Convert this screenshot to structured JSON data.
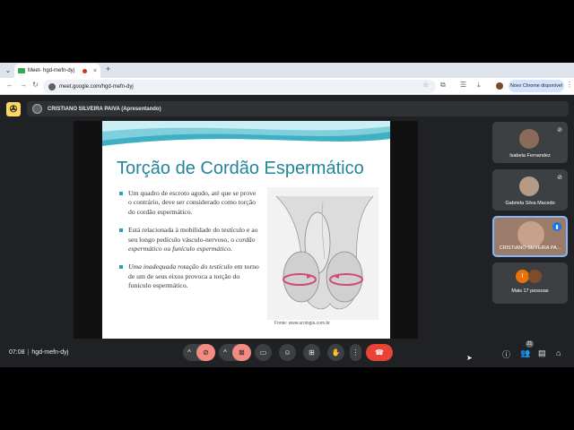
{
  "browser": {
    "tab_title": "Meet- hgd-mefn-dyj",
    "tab_close": "×",
    "new_tab": "+",
    "url": "meet.google.com/hgd-mefn-dyj",
    "update_button": "Novo Chrome disponível",
    "icons": [
      "tab-search-icon",
      "back-icon",
      "forward-icon",
      "reload-icon",
      "site-info-icon",
      "star-icon",
      "extensions-icon",
      "bookmarks-icon",
      "download-icon",
      "kebab-icon"
    ]
  },
  "meet": {
    "logo_label": "✇",
    "presenter_label": "CRISTIANO SILVEIRA PAIVA (Apresentando)",
    "time": "07:08",
    "meeting_code": "hgd-mefn-dyj",
    "participants_count": "21"
  },
  "slide": {
    "title": "Torção de Cordão Espermático",
    "bullets": [
      {
        "text": "Um quadro de escroto agudo, até que se prove o contrário, deve ser considerado como torção do cordão espermático.",
        "italic": ""
      },
      {
        "text": "Está relacionada à mobilidade do testículo e ao seu longo pedículo vásculo-nervoso, o ",
        "italic": "cordão espermático ou funículo espermático."
      },
      {
        "text": "",
        "italic": "Uma inadequada rotação do testículo",
        "tail": " em torno de um de seus eixos provoca a torção do funículo espermático."
      }
    ],
    "credit": "Fonte: www.urologia.com.br"
  },
  "participants": [
    {
      "name": "Isabela Fernandez",
      "avatar_color": "#8a6a5a"
    },
    {
      "name": "Gabriela Silva Macedo",
      "avatar_color": "#b59a87"
    },
    {
      "name": "CRISTIANO SILVEIRA PA...",
      "avatar_color": "#c9a089"
    },
    {
      "name": "Mais 17 pessoas",
      "initial": "I"
    }
  ],
  "colors": {
    "meet_bg": "#202124",
    "tile_bg": "#3c4043",
    "accent": "#8ab4f8",
    "hangup": "#ea4335",
    "slide_title": "#21869a"
  }
}
